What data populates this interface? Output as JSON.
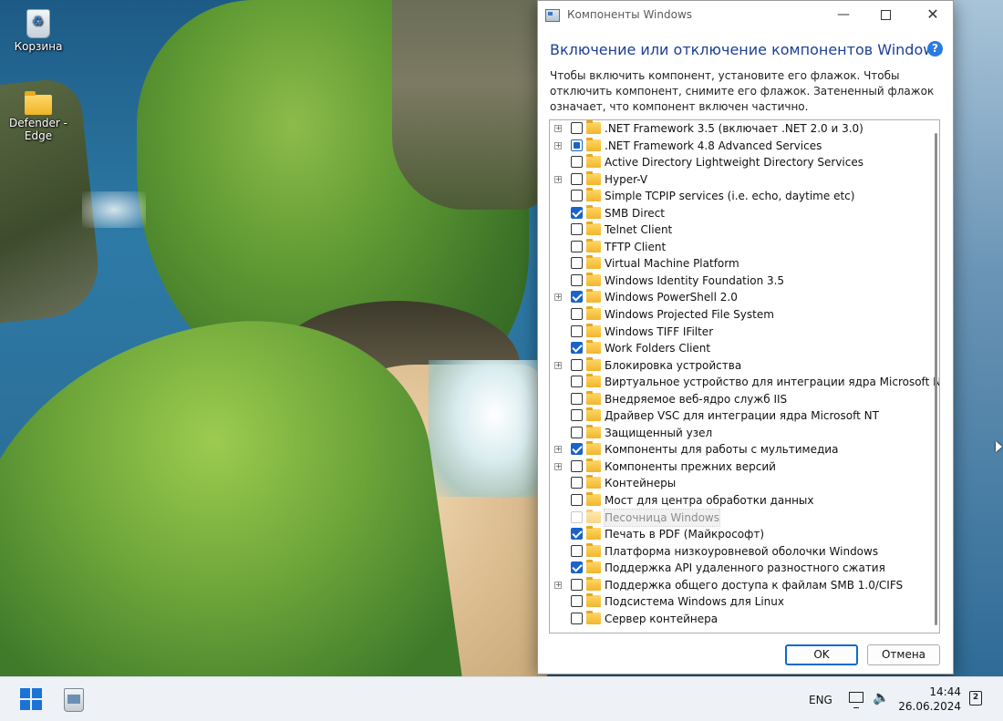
{
  "desktop": {
    "icons": [
      {
        "label": "Корзина",
        "icon": "recycle-bin-icon"
      },
      {
        "label": "Defender - Edge",
        "icon": "folder-icon"
      }
    ]
  },
  "window": {
    "title": "Компоненты Windows",
    "heading": "Включение или отключение компонентов Windows",
    "description": "Чтобы включить компонент, установите его флажок. Чтобы отключить компонент, снимите его флажок. Затененный флажок означает, что компонент включен частично.",
    "features": [
      {
        "label": ".NET Framework 3.5 (включает .NET 2.0 и 3.0)",
        "expandable": true,
        "state": "unchecked"
      },
      {
        "label": ".NET Framework 4.8 Advanced Services",
        "expandable": true,
        "state": "partial"
      },
      {
        "label": "Active Directory Lightweight Directory Services",
        "expandable": false,
        "state": "unchecked"
      },
      {
        "label": "Hyper-V",
        "expandable": true,
        "state": "unchecked"
      },
      {
        "label": "Simple TCPIP services (i.e. echo, daytime etc)",
        "expandable": false,
        "state": "unchecked"
      },
      {
        "label": "SMB Direct",
        "expandable": false,
        "state": "checked"
      },
      {
        "label": "Telnet Client",
        "expandable": false,
        "state": "unchecked"
      },
      {
        "label": "TFTP Client",
        "expandable": false,
        "state": "unchecked"
      },
      {
        "label": "Virtual Machine Platform",
        "expandable": false,
        "state": "unchecked"
      },
      {
        "label": "Windows Identity Foundation 3.5",
        "expandable": false,
        "state": "unchecked"
      },
      {
        "label": "Windows PowerShell 2.0",
        "expandable": true,
        "state": "checked"
      },
      {
        "label": "Windows Projected File System",
        "expandable": false,
        "state": "unchecked"
      },
      {
        "label": "Windows TIFF IFilter",
        "expandable": false,
        "state": "unchecked"
      },
      {
        "label": "Work Folders Client",
        "expandable": false,
        "state": "checked"
      },
      {
        "label": "Блокировка устройства",
        "expandable": true,
        "state": "unchecked"
      },
      {
        "label": "Виртуальное устройство для интеграции ядра Microsoft NT",
        "expandable": false,
        "state": "unchecked"
      },
      {
        "label": "Внедряемое веб-ядро служб IIS",
        "expandable": false,
        "state": "unchecked"
      },
      {
        "label": "Драйвер VSC для интеграции ядра Microsoft NT",
        "expandable": false,
        "state": "unchecked"
      },
      {
        "label": "Защищенный узел",
        "expandable": false,
        "state": "unchecked"
      },
      {
        "label": "Компоненты для работы с мультимедиа",
        "expandable": true,
        "state": "checked"
      },
      {
        "label": "Компоненты прежних версий",
        "expandable": true,
        "state": "unchecked"
      },
      {
        "label": "Контейнеры",
        "expandable": false,
        "state": "unchecked"
      },
      {
        "label": "Мост для центра обработки данных",
        "expandable": false,
        "state": "unchecked"
      },
      {
        "label": "Песочница Windows",
        "expandable": false,
        "state": "disabled",
        "selected": true
      },
      {
        "label": "Печать в PDF (Майкрософт)",
        "expandable": false,
        "state": "checked"
      },
      {
        "label": "Платформа низкоуровневой оболочки Windows",
        "expandable": false,
        "state": "unchecked"
      },
      {
        "label": "Поддержка API удаленного разностного сжатия",
        "expandable": false,
        "state": "checked"
      },
      {
        "label": "Поддержка общего доступа к файлам SMB 1.0/CIFS",
        "expandable": true,
        "state": "unchecked"
      },
      {
        "label": "Подсистема Windows для Linux",
        "expandable": false,
        "state": "unchecked"
      },
      {
        "label": "Сервер контейнера",
        "expandable": false,
        "state": "unchecked"
      }
    ],
    "ok_label": "OK",
    "cancel_label": "Отмена"
  },
  "taskbar": {
    "language": "ENG",
    "time": "14:44",
    "date": "26.06.2024"
  }
}
